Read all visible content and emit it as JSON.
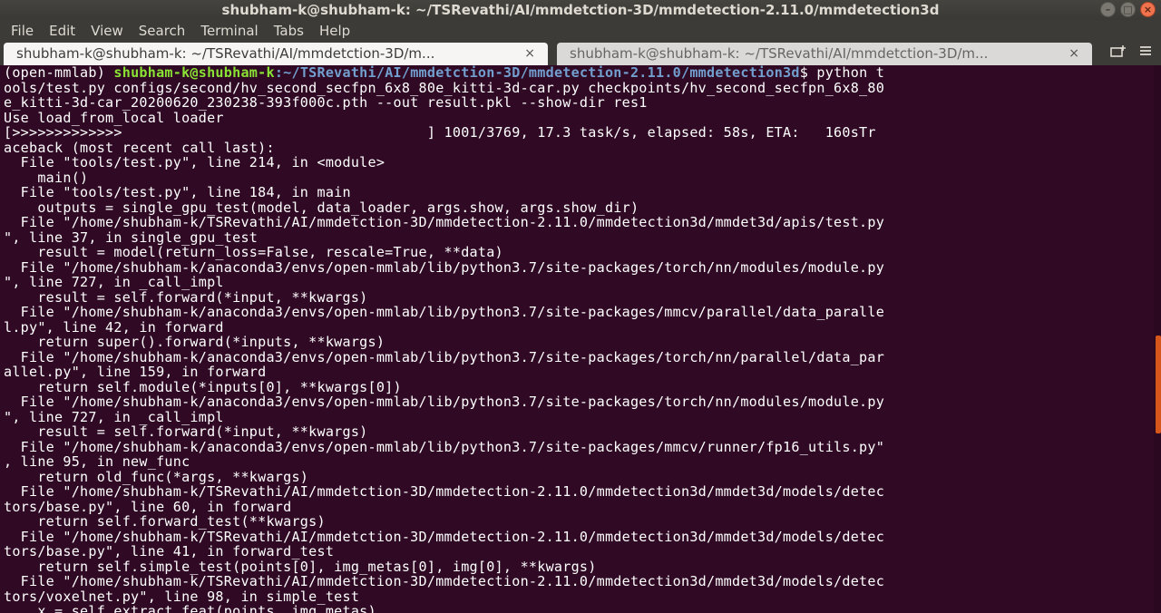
{
  "window": {
    "title": "shubham-k@shubham-k: ~/TSRevathi/AI/mmdetction-3D/mmdetection-2.11.0/mmdetection3d",
    "controls": {
      "minimize": "–",
      "maximize": "□",
      "close": "×"
    }
  },
  "menu": [
    "File",
    "Edit",
    "View",
    "Search",
    "Terminal",
    "Tabs",
    "Help"
  ],
  "tabs": [
    {
      "label": "shubham-k@shubham-k: ~/TSRevathi/AI/mmdetction-3D/m...",
      "close": "×"
    },
    {
      "label": "shubham-k@shubham-k: ~/TSRevathi/AI/mmdetction-3D/m...",
      "close": "×"
    }
  ],
  "tab_actions": {
    "new_tab_icon": "new-tab-icon",
    "menu_icon": "tab-menu-icon"
  },
  "prompt": {
    "env": "(open-mmlab) ",
    "user": "shubham-k@shubham-k",
    "path": ":~/TSRevathi/AI/mmdetction-3D/mmdetection-2.11.0/mmdetection3d",
    "cmd": "$ python t"
  },
  "output": [
    "ools/test.py configs/second/hv_second_secfpn_6x8_80e_kitti-3d-car.py checkpoints/hv_second_secfpn_6x8_80",
    "e_kitti-3d-car_20200620_230238-393f000c.pth --out result.pkl --show-dir res1",
    "Use load_from_local loader",
    "[>>>>>>>>>>>>>                                    ] 1001/3769, 17.3 task/s, elapsed: 58s, ETA:   160sTr",
    "aceback (most recent call last):",
    "  File \"tools/test.py\", line 214, in <module>",
    "    main()",
    "  File \"tools/test.py\", line 184, in main",
    "    outputs = single_gpu_test(model, data_loader, args.show, args.show_dir)",
    "  File \"/home/shubham-k/TSRevathi/AI/mmdetction-3D/mmdetection-2.11.0/mmdetection3d/mmdet3d/apis/test.py",
    "\", line 37, in single_gpu_test",
    "    result = model(return_loss=False, rescale=True, **data)",
    "  File \"/home/shubham-k/anaconda3/envs/open-mmlab/lib/python3.7/site-packages/torch/nn/modules/module.py",
    "\", line 727, in _call_impl",
    "    result = self.forward(*input, **kwargs)",
    "  File \"/home/shubham-k/anaconda3/envs/open-mmlab/lib/python3.7/site-packages/mmcv/parallel/data_paralle",
    "l.py\", line 42, in forward",
    "    return super().forward(*inputs, **kwargs)",
    "  File \"/home/shubham-k/anaconda3/envs/open-mmlab/lib/python3.7/site-packages/torch/nn/parallel/data_par",
    "allel.py\", line 159, in forward",
    "    return self.module(*inputs[0], **kwargs[0])",
    "  File \"/home/shubham-k/anaconda3/envs/open-mmlab/lib/python3.7/site-packages/torch/nn/modules/module.py",
    "\", line 727, in _call_impl",
    "    result = self.forward(*input, **kwargs)",
    "  File \"/home/shubham-k/anaconda3/envs/open-mmlab/lib/python3.7/site-packages/mmcv/runner/fp16_utils.py\"",
    ", line 95, in new_func",
    "    return old_func(*args, **kwargs)",
    "  File \"/home/shubham-k/TSRevathi/AI/mmdetction-3D/mmdetection-2.11.0/mmdetection3d/mmdet3d/models/detec",
    "tors/base.py\", line 60, in forward",
    "    return self.forward_test(**kwargs)",
    "  File \"/home/shubham-k/TSRevathi/AI/mmdetction-3D/mmdetection-2.11.0/mmdetection3d/mmdet3d/models/detec",
    "tors/base.py\", line 41, in forward_test",
    "    return self.simple_test(points[0], img_metas[0], img[0], **kwargs)",
    "  File \"/home/shubham-k/TSRevathi/AI/mmdetction-3D/mmdetection-2.11.0/mmdetection3d/mmdet3d/models/detec",
    "tors/voxelnet.py\", line 98, in simple_test",
    "    x = self.extract_feat(points, img_metas)"
  ]
}
